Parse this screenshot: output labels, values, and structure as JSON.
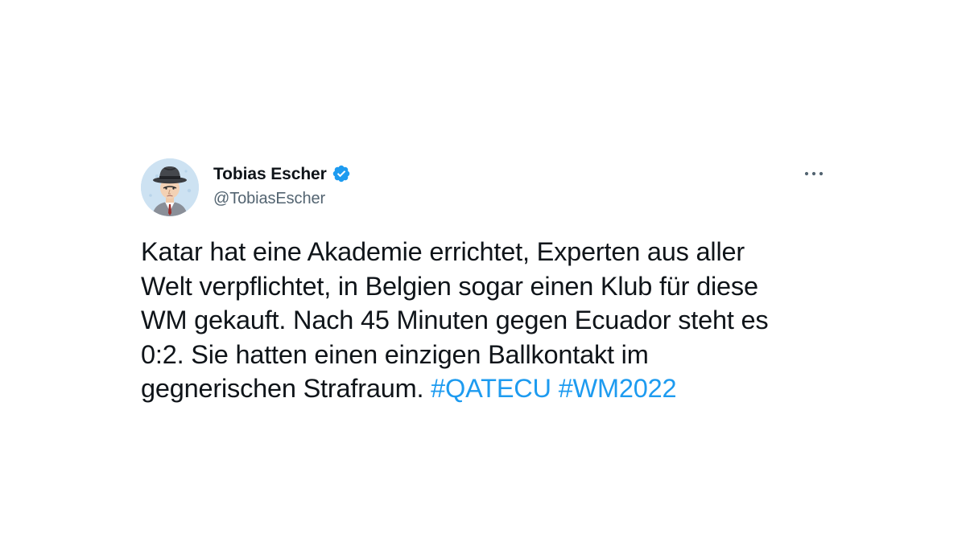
{
  "author": {
    "display_name": "Tobias Escher",
    "handle": "@TobiasEscher",
    "verified": true,
    "avatar": "fedora-man-cartoon-avatar"
  },
  "tweet": {
    "lines": [
      "Katar hat eine Akademie errichtet, Experten aus aller",
      "Welt verpflichtet, in Belgien sogar einen Klub für diese",
      "WM gekauft. Nach 45 Minuten gegen Ecuador steht es",
      "0:2. Sie hatten einen einzigen Ballkontakt im",
      "gegnerischen Strafraum."
    ],
    "hashtags": [
      "#QATECU",
      "#WM2022"
    ]
  },
  "icons": {
    "verified": "verified-badge-icon",
    "more": "more-options-icon"
  },
  "colors": {
    "text": "#0f1419",
    "secondary": "#536471",
    "link": "#1d9bf0",
    "background": "#ffffff"
  }
}
